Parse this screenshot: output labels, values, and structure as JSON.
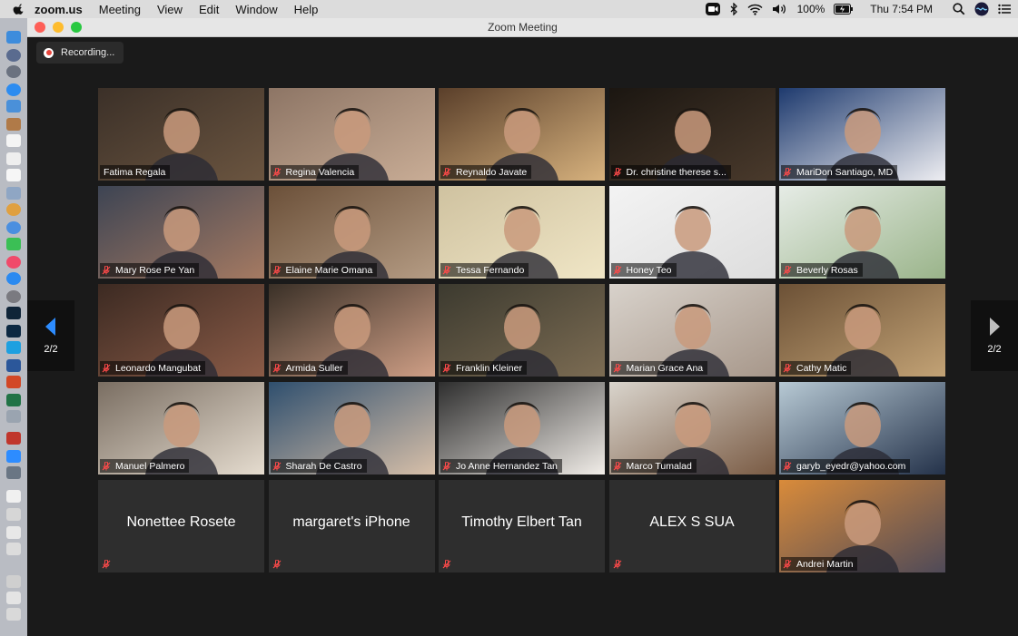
{
  "menubar": {
    "app": "zoom.us",
    "items": [
      "Meeting",
      "View",
      "Edit",
      "Window",
      "Help"
    ],
    "battery": "100%",
    "clock": "Thu 7:54 PM"
  },
  "window": {
    "title": "Zoom Meeting"
  },
  "recording": {
    "label": "Recording..."
  },
  "pager": {
    "left_count": "2/2",
    "right_count": "2/2"
  },
  "participants": [
    {
      "name": "Fatima Regala",
      "muted": false,
      "active": true,
      "video": true,
      "tone": [
        "#3b3028",
        "#6b5540"
      ]
    },
    {
      "name": "Regina Valencia",
      "muted": true,
      "video": true,
      "tone": [
        "#8d7565",
        "#c9ad96"
      ]
    },
    {
      "name": "Reynaldo Javate",
      "muted": true,
      "video": true,
      "tone": [
        "#5a3f2a",
        "#d7b27e"
      ]
    },
    {
      "name": "Dr. christine therese s...",
      "muted": true,
      "video": true,
      "tone": [
        "#1b1611",
        "#4a3a2c"
      ]
    },
    {
      "name": "MariDon Santiago, MD",
      "muted": true,
      "video": true,
      "tone": [
        "#1e3a6e",
        "#eeeef2"
      ]
    },
    {
      "name": "Mary Rose Pe Yan",
      "muted": true,
      "video": true,
      "tone": [
        "#3d4453",
        "#a57a62"
      ]
    },
    {
      "name": "Elaine Marie Omana",
      "muted": true,
      "video": true,
      "tone": [
        "#6b5039",
        "#b59c84"
      ]
    },
    {
      "name": "Tessa Fernando",
      "muted": true,
      "video": true,
      "tone": [
        "#cfc2a0",
        "#f0e6c6"
      ]
    },
    {
      "name": "Honey Teo",
      "muted": true,
      "video": true,
      "tone": [
        "#f3f3f3",
        "#ddd"
      ]
    },
    {
      "name": "Beverly Rosas",
      "muted": true,
      "video": true,
      "tone": [
        "#e6ece6",
        "#9ab48a"
      ]
    },
    {
      "name": "Leonardo Mangubat",
      "muted": true,
      "video": true,
      "tone": [
        "#3c2a22",
        "#8a5b47"
      ]
    },
    {
      "name": "Armida Suller",
      "muted": true,
      "video": true,
      "tone": [
        "#3a3027",
        "#cf9f86"
      ]
    },
    {
      "name": "Franklin Kleiner",
      "muted": true,
      "video": true,
      "tone": [
        "#3c3a2f",
        "#7c6c53"
      ]
    },
    {
      "name": "Marian Grace Ana",
      "muted": true,
      "video": true,
      "tone": [
        "#d8d2cb",
        "#a7978a"
      ]
    },
    {
      "name": "Cathy Matic",
      "muted": true,
      "video": true,
      "tone": [
        "#6c5136",
        "#c2a275"
      ]
    },
    {
      "name": "Manuel Palmero",
      "muted": true,
      "video": true,
      "tone": [
        "#7a6e62",
        "#e5dccf"
      ]
    },
    {
      "name": "Sharah De Castro",
      "muted": true,
      "video": true,
      "tone": [
        "#2f4f6e",
        "#d8c0a9"
      ]
    },
    {
      "name": "Jo Anne Hernandez Tan",
      "muted": true,
      "video": true,
      "tone": [
        "#2e2e2e",
        "#f1ede8"
      ]
    },
    {
      "name": "Marco Tumalad",
      "muted": true,
      "video": true,
      "tone": [
        "#d9d4cc",
        "#7a5b44"
      ]
    },
    {
      "name": "garyb_eyedr@yahoo.com",
      "muted": true,
      "video": true,
      "tone": [
        "#b7c9d4",
        "#24324a"
      ]
    },
    {
      "name": "Nonettee Rosete",
      "muted": true,
      "video": false
    },
    {
      "name": "margaret's iPhone",
      "muted": true,
      "video": false
    },
    {
      "name": "Timothy Elbert Tan",
      "muted": true,
      "video": false
    },
    {
      "name": "ALEX S SUA",
      "muted": true,
      "video": false
    },
    {
      "name": "Andrei Martin",
      "muted": true,
      "video": true,
      "tone": [
        "#d98b3a",
        "#4f4a58"
      ]
    }
  ]
}
